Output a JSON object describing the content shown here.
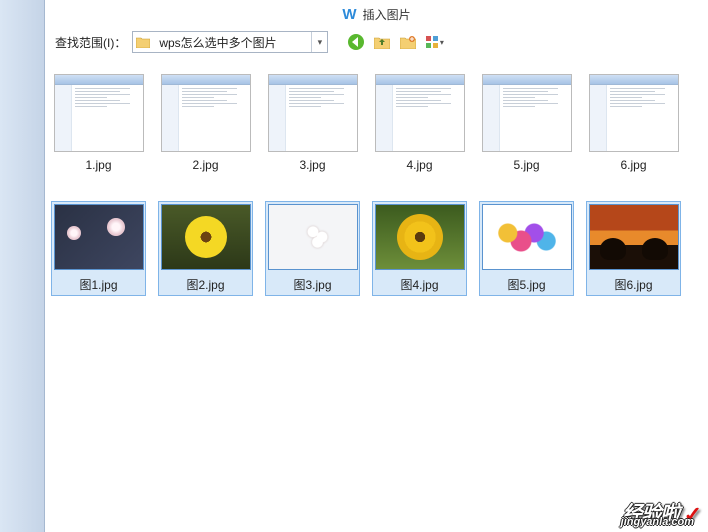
{
  "header": {
    "logo_glyph": "W",
    "title": "插入图片"
  },
  "toolbar": {
    "lookin_label": "查找范围(I)：",
    "path": "wps怎么选中多个图片",
    "icons": {
      "back": "back-icon",
      "up": "folder-up-icon",
      "new": "folder-new-icon",
      "view": "view-grid-icon"
    }
  },
  "files_row1": [
    {
      "name": "1.jpg",
      "kind": "screenshot",
      "selected": false
    },
    {
      "name": "2.jpg",
      "kind": "screenshot",
      "selected": false
    },
    {
      "name": "3.jpg",
      "kind": "screenshot",
      "selected": false
    },
    {
      "name": "4.jpg",
      "kind": "screenshot",
      "selected": false
    },
    {
      "name": "5.jpg",
      "kind": "screenshot",
      "selected": false
    },
    {
      "name": "6.jpg",
      "kind": "screenshot",
      "selected": false
    }
  ],
  "files_row2": [
    {
      "name": "图1.jpg",
      "kind": "photo1",
      "selected": true
    },
    {
      "name": "图2.jpg",
      "kind": "photo2",
      "selected": true
    },
    {
      "name": "图3.jpg",
      "kind": "photo3",
      "selected": true
    },
    {
      "name": "图4.jpg",
      "kind": "photo4",
      "selected": true
    },
    {
      "name": "图5.jpg",
      "kind": "photo5",
      "selected": true
    },
    {
      "name": "图6.jpg",
      "kind": "photo6",
      "selected": true
    }
  ],
  "watermark": {
    "text_cn": "经验啦",
    "check": "✓",
    "domain": "jingyanla.com"
  }
}
